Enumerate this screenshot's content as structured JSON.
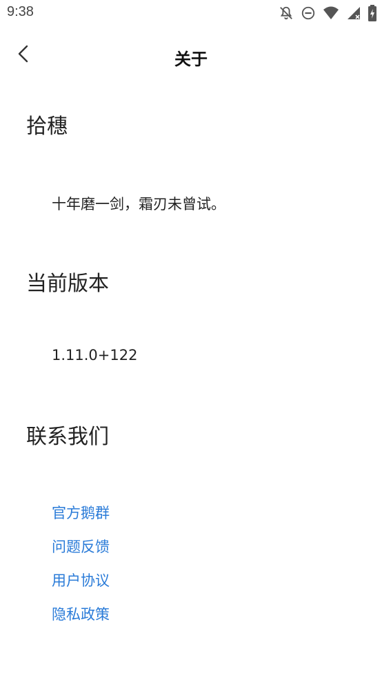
{
  "status": {
    "time": "9:38",
    "icons": [
      "notifications-off-icon",
      "do-not-disturb-icon",
      "wifi-icon",
      "signal-icon",
      "battery-icon"
    ]
  },
  "appbar": {
    "title": "关于",
    "back_icon": "chevron-left-icon"
  },
  "sections": {
    "app": {
      "heading": "拾穗",
      "text": "十年磨一剑，霜刃未曾试。"
    },
    "version": {
      "heading": "当前版本",
      "value": "1.11.0+122"
    },
    "contact": {
      "heading": "联系我们",
      "links": [
        "官方鹅群",
        "问题反馈",
        "用户协议",
        "隐私政策"
      ]
    }
  },
  "colors": {
    "link": "#2a7bd8",
    "text": "#222222",
    "background": "#ffffff"
  }
}
